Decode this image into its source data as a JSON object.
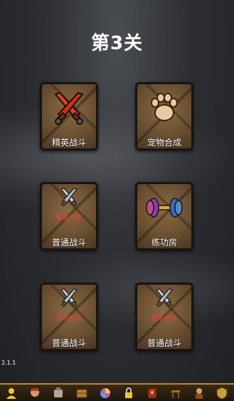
{
  "stage": {
    "title": "第3关"
  },
  "tiles": [
    {
      "label": "精英战斗",
      "icon": "crossed-red-swords-icon"
    },
    {
      "label": "宠物合成",
      "icon": "paw-print-icon"
    },
    {
      "label": "普通战斗",
      "sub": "飘忽不定",
      "icon": "crossed-swords-icon"
    },
    {
      "label": "练功房",
      "icon": "dumbbell-icon"
    },
    {
      "label": "普通战斗",
      "sub": "冰冻打击",
      "icon": "crossed-swords-icon"
    },
    {
      "label": "普通战斗",
      "sub": "菁系疗法",
      "icon": "crossed-swords-icon"
    }
  ],
  "version": "2.1.1",
  "dock": {
    "items": [
      "user-icon",
      "hero-icon",
      "armor-icon",
      "crate-icon",
      "orb-icon",
      "lock-icon",
      "book-icon",
      "stool-icon",
      "barbarian-icon",
      "shield-icon"
    ]
  },
  "colors": {
    "accent": "#ff3b2f",
    "tile": "#6b5032",
    "dock_border": "#b8892b"
  }
}
